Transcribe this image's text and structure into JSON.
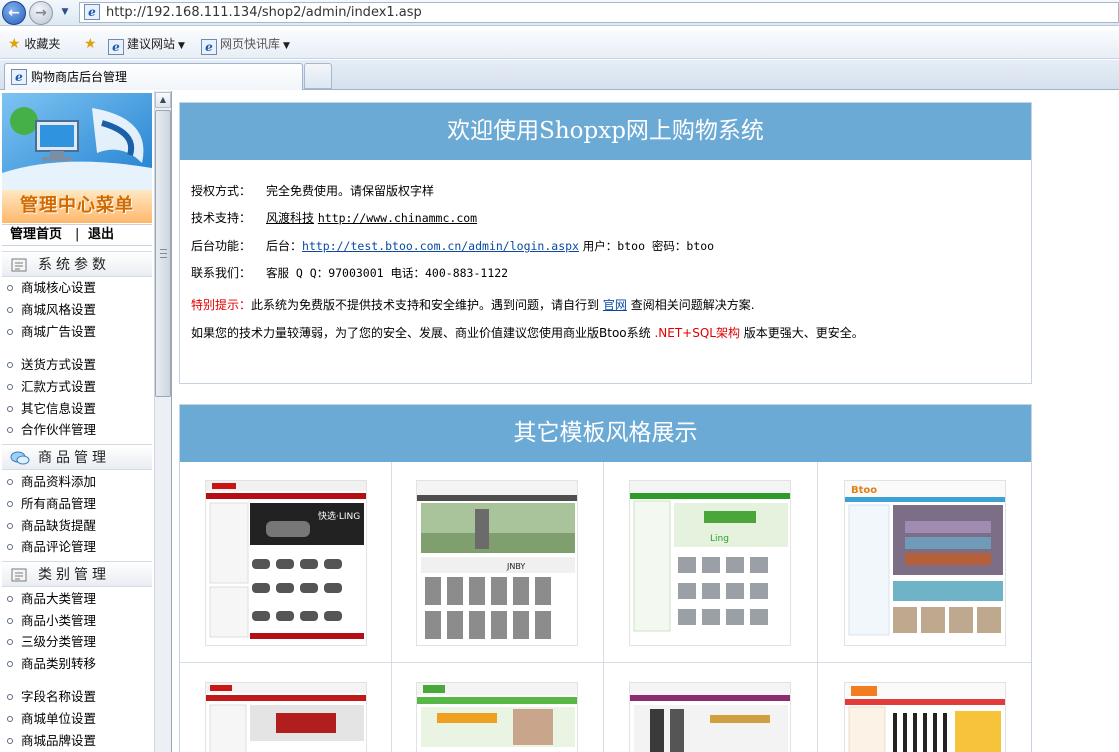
{
  "browser": {
    "url": "http://192.168.111.134/shop2/admin/index1.asp",
    "favorites_label": "收藏夹",
    "suggested_sites_label": "建议网站",
    "web_slice_label": "网页快讯库",
    "tab_title": "购物商店后台管理"
  },
  "sidebar": {
    "menu_title": "管理中心菜单",
    "home_link": "管理首页",
    "separator": "|",
    "logout_link": "退出",
    "sections": [
      {
        "title": "系统参数",
        "items": [
          "商城核心设置",
          "商城风格设置",
          "商城广告设置",
          "送货方式设置",
          "汇款方式设置",
          "其它信息设置",
          "合作伙伴管理"
        ]
      },
      {
        "title": "商品管理",
        "items": [
          "商品资料添加",
          "所有商品管理",
          "商品缺货提醒",
          "商品评论管理"
        ]
      },
      {
        "title": "类别管理",
        "items": [
          "商品大类管理",
          "商品小类管理",
          "三级分类管理",
          "商品类别转移",
          "字段名称设置",
          "商城单位设置",
          "商城品牌设置"
        ]
      }
    ]
  },
  "welcome": {
    "title": "欢迎使用Shopxp网上购物系统",
    "license_label": "授权方式：",
    "license_value": "完全免费使用。请保留版权字样",
    "support_label": "技术支持：",
    "support_name": "风渡科技",
    "support_url": "http://www.chinammc.com",
    "backend_label": "后台功能：",
    "backend_prefix": "后台：",
    "backend_url": "http://test.btoo.com.cn/admin/login.aspx",
    "backend_user": "用户：btoo 密码：btoo",
    "contact_label": "联系我们：",
    "contact_value": "客服 Q Q：97003001 电话：400-883-1122",
    "notice_label": "特别提示：",
    "notice_text": "此系统为免费版不提供技术支持和安全维护。遇到问题，请自行到",
    "notice_link": "官网",
    "notice_tail": "查阅相关问题解决方案.",
    "promo_text": "如果您的技术力量较薄弱，为了您的安全、发展、商业价值建议您使用商业版Btoo系统",
    "promo_highlight": ".NET+SQL架构",
    "promo_tail": "版本更强大、更安全。"
  },
  "templates": {
    "title": "其它模板风格展示",
    "banner_texts": [
      "快选·LING",
      "JNBY",
      "Ling",
      "Btoo"
    ]
  },
  "colors": {
    "header_blue": "#6caad6",
    "menu_orange": "#d26a00",
    "notice_red": "#e00000",
    "link_blue": "#0a4aa4"
  }
}
